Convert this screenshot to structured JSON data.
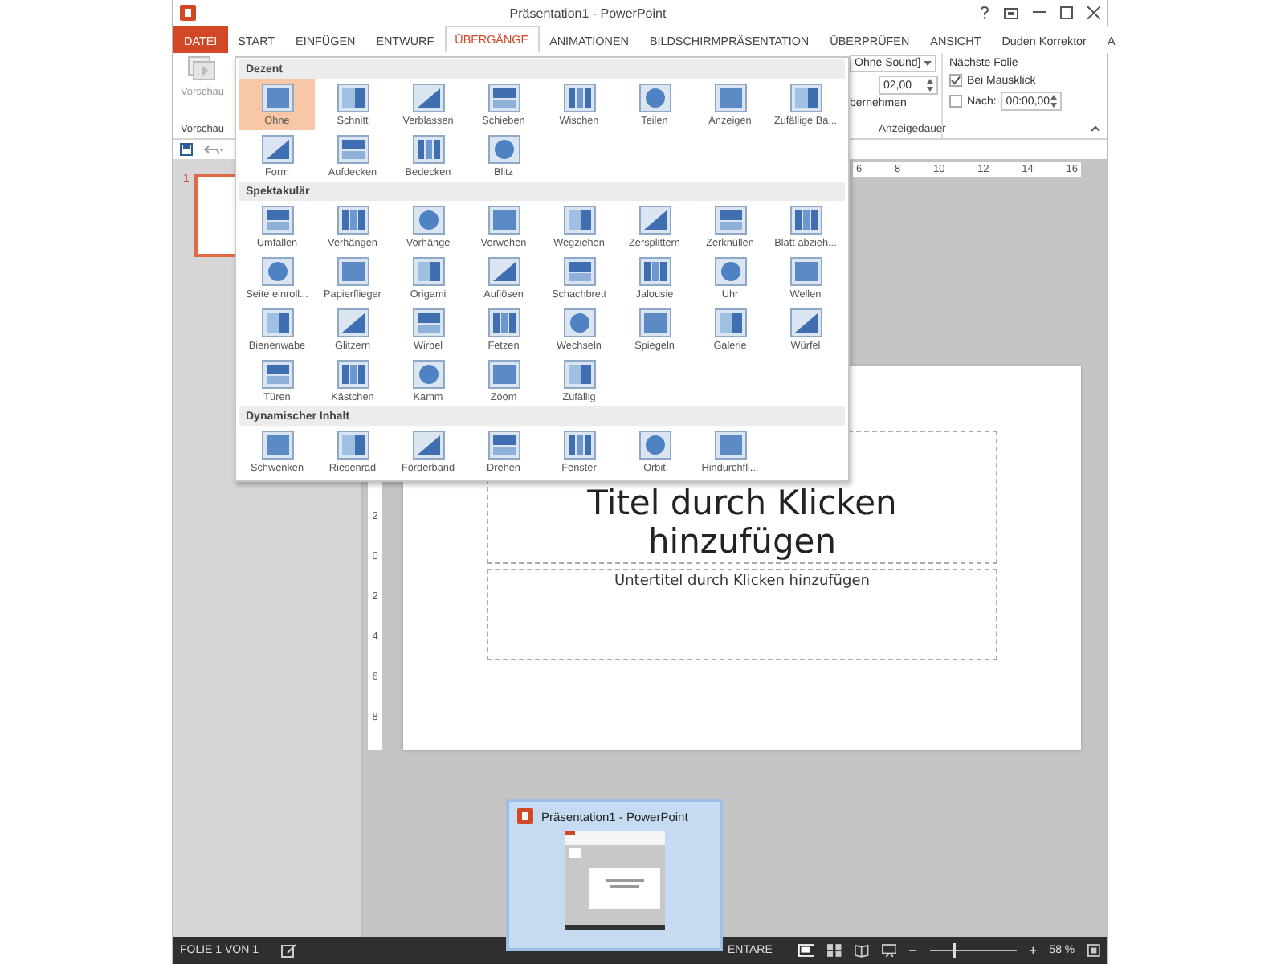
{
  "window": {
    "title": "Präsentation1 - PowerPoint"
  },
  "tabs": [
    {
      "label": "DATEI",
      "kind": "file",
      "selected": false
    },
    {
      "label": "START",
      "kind": "tab",
      "selected": false
    },
    {
      "label": "EINFÜGEN",
      "kind": "tab",
      "selected": false
    },
    {
      "label": "ENTWURF",
      "kind": "tab",
      "selected": false
    },
    {
      "label": "ÜBERGÄNGE",
      "kind": "tab",
      "selected": true
    },
    {
      "label": "ANIMATIONEN",
      "kind": "tab",
      "selected": false
    },
    {
      "label": "BILDSCHIRMPRÄSENTATION",
      "kind": "tab",
      "selected": false
    },
    {
      "label": "ÜBERPRÜFEN",
      "kind": "tab",
      "selected": false
    },
    {
      "label": "ANSICHT",
      "kind": "tab",
      "selected": false
    },
    {
      "label": "Duden Korrektor",
      "kind": "tab",
      "selected": false
    },
    {
      "label": "A",
      "kind": "tab",
      "selected": false
    }
  ],
  "ribbon": {
    "preview": {
      "button": "Vorschau",
      "group": "Vorschau"
    },
    "timing": {
      "sound": "Ohne Sound]",
      "duration": "02,00",
      "apply": "bernehmen",
      "group": "Anzeigedauer"
    },
    "next_slide": {
      "title": "Nächste Folie",
      "on_click": {
        "label": "Bei Mausklick",
        "checked": true
      },
      "after": {
        "label": "Nach:",
        "checked": false,
        "value": "00:00,00"
      }
    }
  },
  "gallery": {
    "sections": [
      {
        "title": "Dezent",
        "items": [
          {
            "label": "Ohne",
            "selected": true
          },
          {
            "label": "Schnitt",
            "selected": false
          },
          {
            "label": "Verblassen",
            "selected": false
          },
          {
            "label": "Schieben",
            "selected": false
          },
          {
            "label": "Wischen",
            "selected": false
          },
          {
            "label": "Teilen",
            "selected": false
          },
          {
            "label": "Anzeigen",
            "selected": false
          },
          {
            "label": "Zufällige Ba...",
            "selected": false
          },
          {
            "label": "Form",
            "selected": false
          },
          {
            "label": "Aufdecken",
            "selected": false
          },
          {
            "label": "Bedecken",
            "selected": false
          },
          {
            "label": "Blitz",
            "selected": false
          }
        ]
      },
      {
        "title": "Spektakulär",
        "items": [
          {
            "label": "Umfallen",
            "selected": false
          },
          {
            "label": "Verhängen",
            "selected": false
          },
          {
            "label": "Vorhänge",
            "selected": false
          },
          {
            "label": "Verwehen",
            "selected": false
          },
          {
            "label": "Wegziehen",
            "selected": false
          },
          {
            "label": "Zersplittern",
            "selected": false
          },
          {
            "label": "Zerknüllen",
            "selected": false
          },
          {
            "label": "Blatt abzieh...",
            "selected": false
          },
          {
            "label": "Seite einroll...",
            "selected": false
          },
          {
            "label": "Papierflieger",
            "selected": false
          },
          {
            "label": "Origami",
            "selected": false
          },
          {
            "label": "Auflösen",
            "selected": false
          },
          {
            "label": "Schachbrett",
            "selected": false
          },
          {
            "label": "Jalousie",
            "selected": false
          },
          {
            "label": "Uhr",
            "selected": false
          },
          {
            "label": "Wellen",
            "selected": false
          },
          {
            "label": "Bienenwabe",
            "selected": false
          },
          {
            "label": "Glitzern",
            "selected": false
          },
          {
            "label": "Wirbel",
            "selected": false
          },
          {
            "label": "Fetzen",
            "selected": false
          },
          {
            "label": "Wechseln",
            "selected": false
          },
          {
            "label": "Spiegeln",
            "selected": false
          },
          {
            "label": "Galerie",
            "selected": false
          },
          {
            "label": "Würfel",
            "selected": false
          },
          {
            "label": "Türen",
            "selected": false
          },
          {
            "label": "Kästchen",
            "selected": false
          },
          {
            "label": "Kamm",
            "selected": false
          },
          {
            "label": "Zoom",
            "selected": false
          },
          {
            "label": "Zufällig",
            "selected": false
          }
        ]
      },
      {
        "title": "Dynamischer Inhalt",
        "items": [
          {
            "label": "Schwenken",
            "selected": false
          },
          {
            "label": "Riesenrad",
            "selected": false
          },
          {
            "label": "Förderband",
            "selected": false
          },
          {
            "label": "Drehen",
            "selected": false
          },
          {
            "label": "Fenster",
            "selected": false
          },
          {
            "label": "Orbit",
            "selected": false
          },
          {
            "label": "Hindurchfli...",
            "selected": false
          }
        ]
      }
    ]
  },
  "slides_pane": {
    "number": "1"
  },
  "rulers": {
    "horizontal": [
      "6",
      "8",
      "10",
      "12",
      "14",
      "16"
    ],
    "vertical": [
      "2",
      "0",
      "2",
      "4",
      "6",
      "8"
    ]
  },
  "slide": {
    "title": "Titel durch Klicken hinzufügen",
    "subtitle": "Untertitel durch Klicken hinzufügen"
  },
  "status_bar": {
    "slide_info": "FOLIE 1 VON 1",
    "comments": "ENTARE",
    "zoom": "58 %",
    "level": 0.27
  },
  "taskbar_preview": {
    "title": "Präsentation1 - PowerPoint"
  }
}
